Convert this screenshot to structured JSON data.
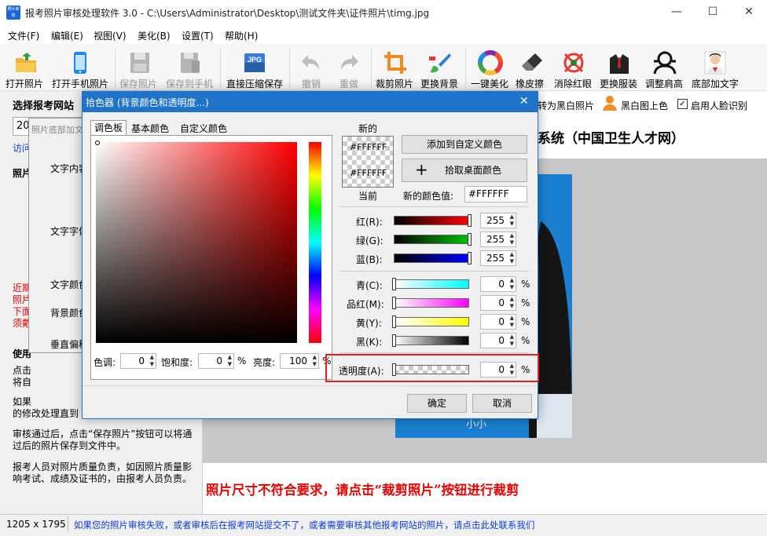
{
  "window": {
    "title": "报考照片审核处理软件 3.0 - C:\\Users\\Administrator\\Desktop\\测试文件夹\\证件照片\\timg.jpg",
    "icon_text": "照片审核",
    "minimize": "—",
    "maximize": "☐",
    "close": "✕"
  },
  "menu": [
    "文件(F)",
    "编辑(E)",
    "视图(V)",
    "美化(B)",
    "设置(T)",
    "帮助(H)"
  ],
  "toolbar": [
    {
      "label": "打开照片",
      "icon": "folder-open-icon",
      "enabled": true
    },
    {
      "label": "打开手机照片",
      "icon": "phone-icon",
      "enabled": true
    },
    {
      "label": "保存照片",
      "icon": "floppy-icon",
      "enabled": false
    },
    {
      "label": "保存到手机",
      "icon": "floppy-phone-icon",
      "enabled": false
    },
    {
      "label": "直接压缩保存",
      "icon": "jpg-icon",
      "icon_text": "JPG",
      "enabled": true
    },
    {
      "label": "撤销",
      "icon": "undo-icon",
      "enabled": false
    },
    {
      "label": "重做",
      "icon": "redo-icon",
      "enabled": false
    },
    {
      "label": "裁剪照片",
      "icon": "crop-icon",
      "enabled": true
    },
    {
      "label": "更换背景",
      "icon": "paint-brush-icon",
      "enabled": true
    },
    {
      "label": "一键美化",
      "icon": "color-wheel-icon",
      "enabled": true
    },
    {
      "label": "橡皮擦",
      "icon": "eraser-icon",
      "enabled": true
    },
    {
      "label": "消除红眼",
      "icon": "red-eye-icon",
      "enabled": true
    },
    {
      "label": "更换服装",
      "icon": "suit-icon",
      "enabled": true
    },
    {
      "label": "调整肩高",
      "icon": "shoulder-icon",
      "enabled": true
    },
    {
      "label": "底部加文字",
      "icon": "portrait-icon",
      "enabled": true
    }
  ],
  "left_panel": {
    "select_site_label": "选择报考网站",
    "select_value": "20",
    "visit_link": "访问",
    "photo_label": "照片",
    "bg_dialog_title": "照片底部加文",
    "bg_dialog_labels": [
      "文字内容",
      "文字字体",
      "文字颜色",
      "背景颜色",
      "垂直偏移"
    ],
    "red_notes": [
      "近期",
      "照片",
      "下面",
      "须戴"
    ],
    "usage_label": "使用",
    "usage_lines": [
      "点击",
      "将自",
      "如果",
      "的修改处理直到"
    ],
    "paragraph1": "审核通过后，点击“保存照片”按钮可以将通过后的照片保存到文件中。",
    "paragraph2": "报考人员对照片质量负责，如因照片质量影响考试、成绩及证书的，由报考人员负责。"
  },
  "right_strip": {
    "bw_label": "转为黑白照片",
    "colorize_label": "黑白图上色",
    "face_detect_label": "启用人脸识别",
    "face_detect_checked": true
  },
  "preview": {
    "system_title": "系统（中国卫生人才网）",
    "watermark": "小小"
  },
  "message": "照片尺寸不符合要求，请点击“裁剪照片”按钮进行裁剪",
  "status": {
    "size": "1205 x 1795",
    "hint": "如果您的照片审核失败，或者审核后在报考网站提交不了，或者需要审核其他报考网站的照片，请点击此处联系我们"
  },
  "color_dialog": {
    "title": "拾色器 (背景颜色和透明度...)",
    "close": "✕",
    "tabs": [
      "调色板",
      "基本颜色",
      "自定义颜色"
    ],
    "active_tab": 0,
    "new_label": "新的",
    "current_label": "当前",
    "new_hex": "#FFFFFF",
    "current_hex": "#FFFFFF",
    "add_custom_button": "添加到自定义颜色",
    "pick_desktop_button": "拾取桌面颜色",
    "new_color_value_label": "新的颜色值:",
    "new_color_value": "#FFFFFF",
    "hue": {
      "label": "色调:",
      "value": "0"
    },
    "saturation": {
      "label": "饱和度:",
      "value": "0",
      "unit": "%"
    },
    "brightness": {
      "label": "亮度:",
      "value": "100",
      "unit": "%"
    },
    "rgb": [
      {
        "label": "红(R):",
        "value": "255",
        "level": 1.0,
        "color": "#ff0000"
      },
      {
        "label": "绿(G):",
        "value": "255",
        "level": 1.0,
        "color": "#00c000"
      },
      {
        "label": "蓝(B):",
        "value": "255",
        "level": 1.0,
        "color": "#0000ff"
      }
    ],
    "cmyk": [
      {
        "label": "青(C):",
        "value": "0",
        "unit": "%",
        "color": "#00ffff"
      },
      {
        "label": "品红(M):",
        "value": "0",
        "unit": "%",
        "color": "#ff00ff"
      },
      {
        "label": "黄(Y):",
        "value": "0",
        "unit": "%",
        "color": "#ffff00"
      },
      {
        "label": "黑(K):",
        "value": "0",
        "unit": "%",
        "color": "#000000"
      }
    ],
    "alpha": {
      "label": "透明度(A):",
      "value": "0",
      "unit": "%"
    },
    "ok_button": "确定",
    "cancel_button": "取消"
  },
  "colors": {
    "title_bar": "#1f73c9",
    "photo_background": "#1a7fd0",
    "warning_red": "#e60000",
    "link_blue": "#0a3cd6",
    "highlight_box": "#e02020"
  }
}
